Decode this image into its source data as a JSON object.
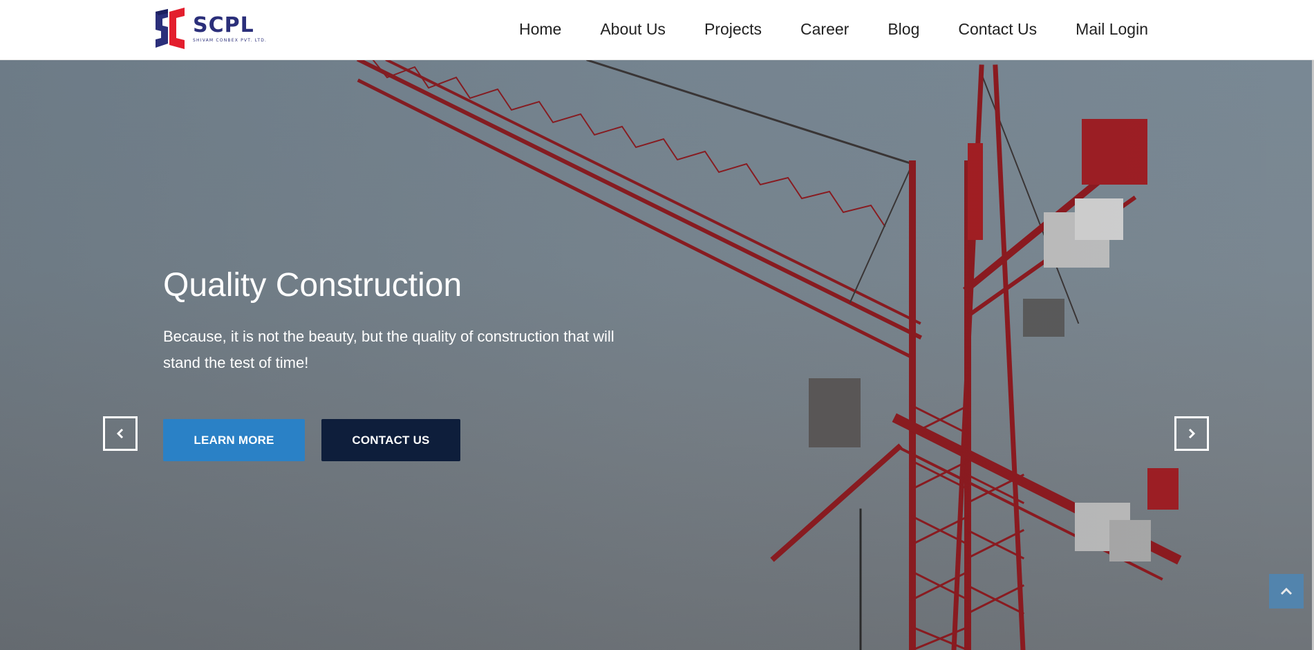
{
  "brand": {
    "name": "SCPL",
    "subtitle": "SHIVAM CONBEX PVT. LTD.",
    "colors": {
      "primary": "#2b2f7a",
      "accent": "#e31e2d"
    }
  },
  "nav": {
    "items": [
      {
        "label": "Home"
      },
      {
        "label": "About Us"
      },
      {
        "label": "Projects"
      },
      {
        "label": "Career"
      },
      {
        "label": "Blog"
      },
      {
        "label": "Contact Us"
      },
      {
        "label": "Mail Login"
      }
    ]
  },
  "hero": {
    "title": "Quality Construction",
    "text": "Because, it is not the beauty, but the quality of construction that will stand the test of time!",
    "learn_more_label": "LEARN MORE",
    "contact_us_label": "CONTACT US",
    "prev_icon": "chevron-left-icon",
    "next_icon": "chevron-right-icon",
    "colors": {
      "learn_more": "#2a81c6",
      "contact_us": "#0e1e3b"
    }
  },
  "scroll_top": {
    "icon": "chevron-up-icon",
    "color": "#4d87b6"
  }
}
